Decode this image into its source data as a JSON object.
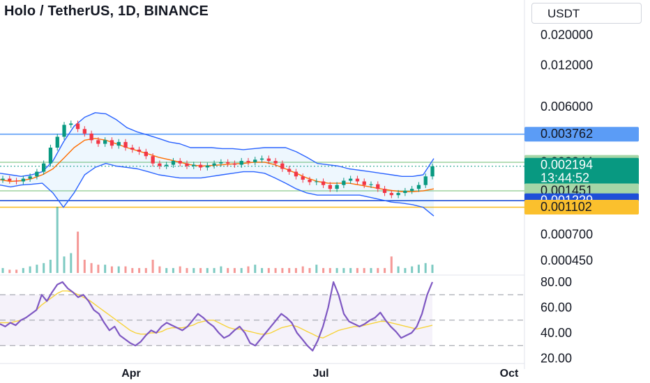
{
  "header": {
    "title": "Holo / TetherUS, 1D, BINANCE",
    "currency": "USDT"
  },
  "chart_data": {
    "type": "candlestick",
    "symbol": "Holo / TetherUS",
    "interval": "1D",
    "exchange": "BINANCE",
    "price_axis": {
      "scale": "log",
      "ticks": [
        "0.020000",
        "0.012000",
        "0.006000",
        "0.000700",
        "0.000450"
      ]
    },
    "x_axis": {
      "ticks": [
        "Apr",
        "Jul",
        "Oct"
      ]
    },
    "price_badges": [
      {
        "label": "0.003762",
        "bg": "#5b9cf6",
        "fg": "#131722"
      },
      {
        "label": "0.002344",
        "bg": "#a5d6a7",
        "fg": "#131722"
      },
      {
        "label": "0.002194",
        "sub": "13:44:52",
        "bg": "#089981",
        "fg": "#ffffff"
      },
      {
        "label": "0.001451",
        "bg": "#a5d6a7",
        "fg": "#131722"
      },
      {
        "label": "0.001229",
        "bg": "#1e4fd8",
        "fg": "#ffffff"
      },
      {
        "label": "0.001102",
        "bg": "#fbc02d",
        "fg": "#131722"
      }
    ],
    "horizontal_lines": [
      {
        "price": 0.003762,
        "color": "#5b9cf6",
        "style": "solid"
      },
      {
        "price": 0.002344,
        "color": "#a5d6a7",
        "style": "solid"
      },
      {
        "price": 0.002194,
        "color": "#089981",
        "style": "dotted"
      },
      {
        "price": 0.001451,
        "color": "#a5d6a7",
        "style": "solid"
      },
      {
        "price": 0.001229,
        "color": "#1e4fd8",
        "style": "solid"
      },
      {
        "price": 0.001102,
        "color": "#fbc02d",
        "style": "solid"
      }
    ],
    "bollinger_bands": {
      "upper": [
        0.00195,
        0.0019,
        0.00185,
        0.0019,
        0.002,
        0.0024,
        0.0033,
        0.0043,
        0.005,
        0.0054,
        0.0053,
        0.0048,
        0.0042,
        0.0039,
        0.0037,
        0.0035,
        0.0033,
        0.0032,
        0.003,
        0.003,
        0.003,
        0.00295,
        0.00295,
        0.0029,
        0.00295,
        0.003,
        0.003,
        0.003,
        0.0028,
        0.00255,
        0.0023,
        0.00225,
        0.0022,
        0.0021,
        0.00205,
        0.002,
        0.00195,
        0.0019,
        0.00185,
        0.00185,
        0.0019,
        0.0025
      ],
      "middle": [
        0.00175,
        0.0017,
        0.00172,
        0.00178,
        0.0019,
        0.0021,
        0.0025,
        0.003,
        0.0034,
        0.0035,
        0.0034,
        0.0032,
        0.003,
        0.00285,
        0.0027,
        0.00255,
        0.00245,
        0.00235,
        0.00225,
        0.0022,
        0.00222,
        0.00225,
        0.00228,
        0.0023,
        0.00235,
        0.00235,
        0.00225,
        0.0021,
        0.00195,
        0.0018,
        0.0017,
        0.00165,
        0.00165,
        0.00165,
        0.0016,
        0.00155,
        0.0015,
        0.00146,
        0.00143,
        0.00143,
        0.00145,
        0.0015
      ],
      "lower": [
        0.0016,
        0.00155,
        0.0016,
        0.00162,
        0.00165,
        0.0014,
        0.0011,
        0.0014,
        0.0019,
        0.00215,
        0.0023,
        0.0022,
        0.00215,
        0.0021,
        0.002,
        0.0019,
        0.00185,
        0.0018,
        0.0018,
        0.0018,
        0.00185,
        0.0019,
        0.00195,
        0.002,
        0.002,
        0.00195,
        0.0018,
        0.00165,
        0.0015,
        0.0014,
        0.00135,
        0.00135,
        0.00135,
        0.00135,
        0.00135,
        0.0013,
        0.00125,
        0.0012,
        0.00118,
        0.00115,
        0.0011,
        0.00095
      ]
    },
    "candles_close": [
      0.00178,
      0.00172,
      0.0017,
      0.00178,
      0.00185,
      0.002,
      0.0023,
      0.003,
      0.0036,
      0.0044,
      0.0045,
      0.0041,
      0.0038,
      0.0034,
      0.0032,
      0.0034,
      0.0031,
      0.0033,
      0.003,
      0.0029,
      0.0028,
      0.0026,
      0.0023,
      0.0022,
      0.00225,
      0.0024,
      0.0023,
      0.0022,
      0.00225,
      0.00215,
      0.00222,
      0.0023,
      0.00235,
      0.0023,
      0.00225,
      0.0024,
      0.00235,
      0.00245,
      0.0025,
      0.0024,
      0.0023,
      0.0021,
      0.002,
      0.00185,
      0.00175,
      0.00168,
      0.0017,
      0.0016,
      0.0015,
      0.0016,
      0.00172,
      0.00178,
      0.0017,
      0.0016,
      0.00162,
      0.0015,
      0.0014,
      0.00135,
      0.0014,
      0.00145,
      0.0015,
      0.0016,
      0.00185,
      0.00219
    ],
    "volume": [
      3,
      2,
      2,
      3,
      4,
      5,
      6,
      8,
      40,
      10,
      12,
      25,
      8,
      6,
      5,
      5,
      4,
      4,
      4,
      3,
      3,
      3,
      8,
      4,
      3,
      3,
      4,
      3,
      3,
      3,
      3,
      3,
      4,
      3,
      3,
      3,
      4,
      5,
      3,
      3,
      3,
      3,
      3,
      3,
      4,
      3,
      5,
      3,
      3,
      3,
      3,
      3,
      3,
      3,
      3,
      3,
      3,
      10,
      4,
      3,
      4,
      5,
      6,
      5
    ],
    "rsi": {
      "axis_ticks": [
        "80.00",
        "60.00",
        "40.00",
        "20.00"
      ],
      "values": [
        47,
        45,
        48,
        46,
        50,
        52,
        55,
        58,
        70,
        65,
        72,
        78,
        80,
        75,
        72,
        68,
        70,
        65,
        58,
        55,
        48,
        42,
        45,
        38,
        35,
        32,
        30,
        33,
        38,
        42,
        40,
        45,
        48,
        46,
        44,
        42,
        45,
        50,
        55,
        52,
        48,
        45,
        40,
        36,
        38,
        42,
        45,
        40,
        32,
        30,
        35,
        40,
        45,
        50,
        55,
        52,
        48,
        40,
        35,
        30,
        26,
        34,
        45,
        60,
        80,
        70,
        55,
        49,
        47,
        45,
        47,
        50,
        52,
        56,
        50,
        45,
        41,
        36,
        38,
        40,
        45,
        55,
        70,
        80
      ],
      "ma": [
        48,
        48,
        48,
        49,
        50,
        52,
        55,
        58,
        62,
        65,
        68,
        71,
        73,
        73,
        72,
        70,
        68,
        66,
        63,
        60,
        57,
        54,
        51,
        48,
        45,
        42,
        40,
        39,
        39,
        40,
        40,
        41,
        43,
        44,
        44,
        44,
        45,
        46,
        48,
        49,
        50,
        50,
        48,
        46,
        44,
        43,
        43,
        42,
        41,
        40,
        39,
        39,
        40,
        42,
        44,
        45,
        46,
        45,
        43,
        41,
        39,
        37,
        36,
        38,
        40,
        42,
        43,
        44,
        45,
        45,
        46,
        47,
        48,
        49,
        49,
        48,
        47,
        46,
        45,
        44,
        43,
        44,
        45,
        46
      ]
    }
  }
}
